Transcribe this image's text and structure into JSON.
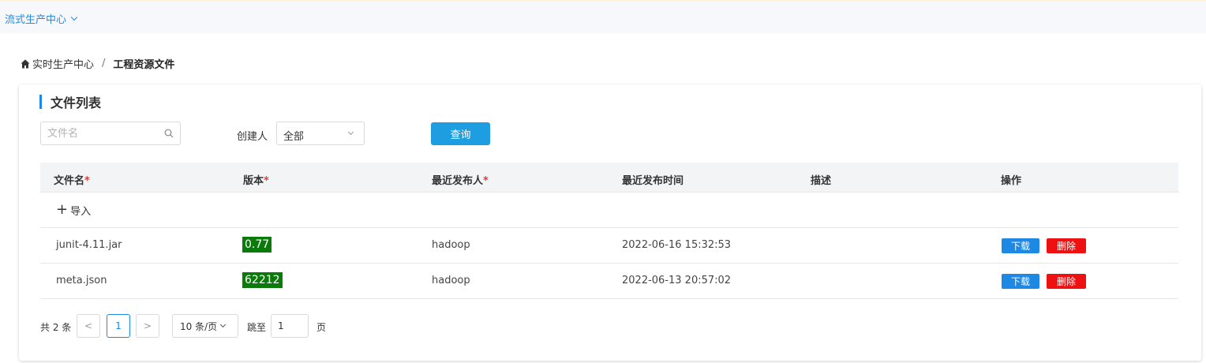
{
  "topbar": {
    "center_switch": "流式生产中心"
  },
  "breadcrumb": {
    "home": "实时生产中心",
    "separator": "/",
    "current": "工程资源文件"
  },
  "panel": {
    "title": "文件列表"
  },
  "filters": {
    "search_placeholder": "文件名",
    "creator_label": "创建人",
    "creator_value": "全部",
    "query_button": "查询"
  },
  "table": {
    "columns": [
      {
        "label": "文件名",
        "required": "*"
      },
      {
        "label": "版本",
        "required": "*"
      },
      {
        "label": "最近发布人",
        "required": "*"
      },
      {
        "label": "最近发布时间",
        "required": ""
      },
      {
        "label": "描述",
        "required": ""
      },
      {
        "label": "操作",
        "required": ""
      }
    ],
    "import_label": "导入",
    "rows": [
      {
        "name": "junit-4.11.jar",
        "version": "0.77",
        "publisher": "hadoop",
        "time": "2022-06-16 15:32:53",
        "desc": "",
        "download": "下载",
        "delete": "删除"
      },
      {
        "name": "meta.json",
        "version": "62212",
        "publisher": "hadoop",
        "time": "2022-06-13 20:57:02",
        "desc": "",
        "download": "下载",
        "delete": "删除"
      }
    ]
  },
  "pagination": {
    "total": "共 2 条",
    "prev": "<",
    "current_page": "1",
    "next": ">",
    "page_size": "10 条/页",
    "jump_label": "跳至",
    "jump_value": "1",
    "page_suffix": "页"
  },
  "colors": {
    "accent": "#1e88e5",
    "query_button": "#1e9de0",
    "version_badge": "#0a7a0a",
    "delete_button": "#ee1111",
    "required_mark": "#e53935"
  }
}
